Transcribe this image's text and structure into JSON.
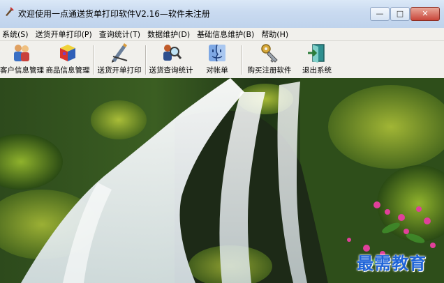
{
  "window": {
    "title": "欢迎使用一点通送货单打印软件V2.16—软件未注册",
    "controls": {
      "minimize": "—",
      "maximize": "□",
      "close": "✕"
    }
  },
  "menu": [
    {
      "label": "系统(S)"
    },
    {
      "label": "送货开单打印(P)"
    },
    {
      "label": "查询统计(T)"
    },
    {
      "label": "数据维护(D)"
    },
    {
      "label": "基础信息维护(B)"
    },
    {
      "label": "帮助(H)"
    }
  ],
  "toolbar": {
    "buttons": [
      {
        "label": "客户信息管理",
        "icon": "people-icon"
      },
      {
        "label": "商品信息管理",
        "icon": "boxes-icon"
      },
      {
        "label": "送货开单打印",
        "icon": "pen-ruler-icon"
      },
      {
        "label": "送货查询统计",
        "icon": "magnifier-icon"
      },
      {
        "label": "对帐单",
        "icon": "finder-face-icon"
      },
      {
        "label": "购买注册软件",
        "icon": "key-icon"
      },
      {
        "label": "退出系统",
        "icon": "exit-door-icon"
      }
    ]
  },
  "watermark": "最需教育"
}
